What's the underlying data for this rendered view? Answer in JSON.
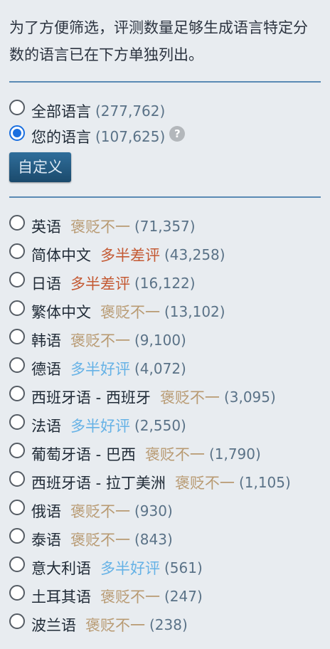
{
  "intro": "为了方便筛选，评测数量足够生成语言特定分数的语言已在下方单独列出。",
  "filters": [
    {
      "label": "全部语言",
      "count": "(277,762)",
      "checked": false
    },
    {
      "label": "您的语言",
      "count": "(107,625)",
      "checked": true,
      "help": "?"
    }
  ],
  "customize_label": "自定义",
  "colors": {
    "mixed": "#b89a72",
    "negative": "#c45a34",
    "positive": "#66b2e6"
  },
  "languages": [
    {
      "name": "英语",
      "rating": "褒贬不一",
      "rating_type": "mixed",
      "count": "(71,357)"
    },
    {
      "name": "简体中文",
      "rating": "多半差评",
      "rating_type": "negative",
      "count": "(43,258)"
    },
    {
      "name": "日语",
      "rating": "多半差评",
      "rating_type": "negative",
      "count": "(16,122)"
    },
    {
      "name": "繁体中文",
      "rating": "褒贬不一",
      "rating_type": "mixed",
      "count": "(13,102)"
    },
    {
      "name": "韩语",
      "rating": "褒贬不一",
      "rating_type": "mixed",
      "count": "(9,100)"
    },
    {
      "name": "德语",
      "rating": "多半好评",
      "rating_type": "positive",
      "count": "(4,072)"
    },
    {
      "name": "西班牙语 - 西班牙",
      "rating": "褒贬不一",
      "rating_type": "mixed",
      "count": "(3,095)"
    },
    {
      "name": "法语",
      "rating": "多半好评",
      "rating_type": "positive",
      "count": "(2,550)"
    },
    {
      "name": "葡萄牙语 - 巴西",
      "rating": "褒贬不一",
      "rating_type": "mixed",
      "count": "(1,790)"
    },
    {
      "name": "西班牙语 - 拉丁美洲",
      "rating": "褒贬不一",
      "rating_type": "mixed",
      "count": "(1,105)"
    },
    {
      "name": "俄语",
      "rating": "褒贬不一",
      "rating_type": "mixed",
      "count": "(930)"
    },
    {
      "name": "泰语",
      "rating": "褒贬不一",
      "rating_type": "mixed",
      "count": "(843)"
    },
    {
      "name": "意大利语",
      "rating": "多半好评",
      "rating_type": "positive",
      "count": "(561)"
    },
    {
      "name": "土耳其语",
      "rating": "褒贬不一",
      "rating_type": "mixed",
      "count": "(247)"
    },
    {
      "name": "波兰语",
      "rating": "褒贬不一",
      "rating_type": "mixed",
      "count": "(238)"
    }
  ]
}
